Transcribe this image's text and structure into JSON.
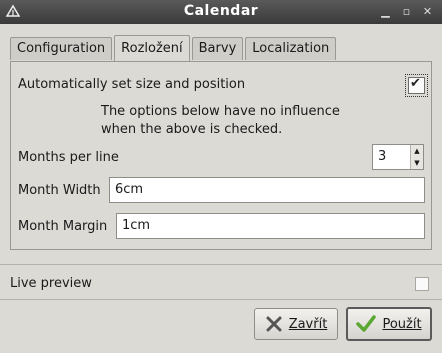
{
  "window": {
    "title": "Calendar"
  },
  "tabs": [
    {
      "label": "Configuration",
      "active": false
    },
    {
      "label": "Rozložení",
      "active": true
    },
    {
      "label": "Barvy",
      "active": false
    },
    {
      "label": "Localization",
      "active": false
    }
  ],
  "layout": {
    "auto_size_label": "Automatically set size and position",
    "auto_size_checked": true,
    "info_line1": "The options below have no influence",
    "info_line2": "when the above is checked.",
    "months_per_line_label": "Months per line",
    "months_per_line_value": "3",
    "month_width_label": "Month Width",
    "month_width_value": "6cm",
    "month_margin_label": "Month Margin",
    "month_margin_value": "1cm"
  },
  "live_preview": {
    "label": "Live preview",
    "checked": false
  },
  "buttons": {
    "close_label": "Zavřít",
    "apply_label": "Použít"
  }
}
